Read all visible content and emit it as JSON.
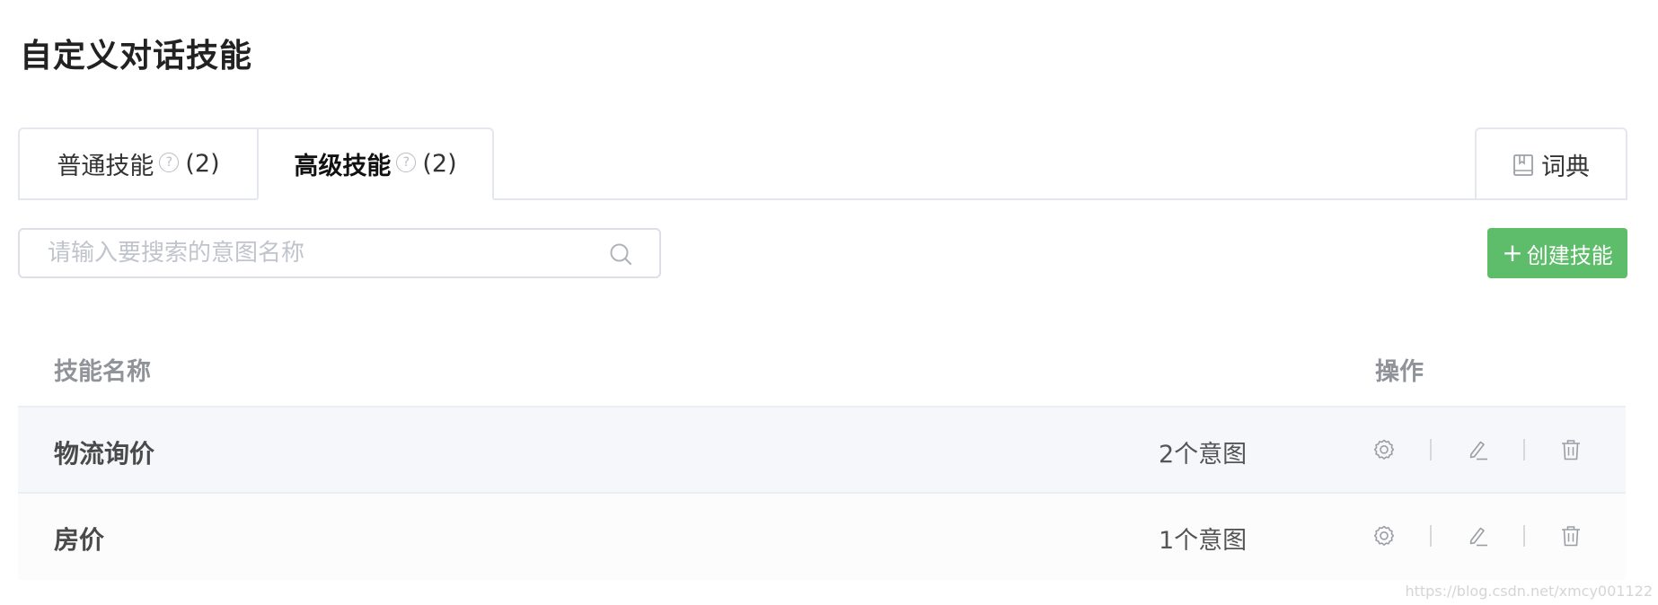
{
  "page": {
    "title": "自定义对话技能"
  },
  "tabs": [
    {
      "label": "普通技能",
      "count": "(2)",
      "active": false
    },
    {
      "label": "高级技能",
      "count": "(2)",
      "active": true
    }
  ],
  "dictionary": {
    "label": "词典",
    "icon": "book-icon"
  },
  "search": {
    "placeholder": "请输入要搜索的意图名称",
    "value": "",
    "icon": "search-icon"
  },
  "create_button": {
    "plus": "+",
    "label": "创建技能",
    "color": "#5ebd6a"
  },
  "table": {
    "columns": {
      "name": "技能名称",
      "operations": "操作"
    },
    "rows": [
      {
        "name": "物流询价",
        "intents": "2个意图"
      },
      {
        "name": "房价",
        "intents": "1个意图"
      }
    ],
    "row_actions": [
      "settings-icon",
      "edit-icon",
      "delete-icon"
    ]
  },
  "watermark": "https://blog.csdn.net/xmcy001122"
}
